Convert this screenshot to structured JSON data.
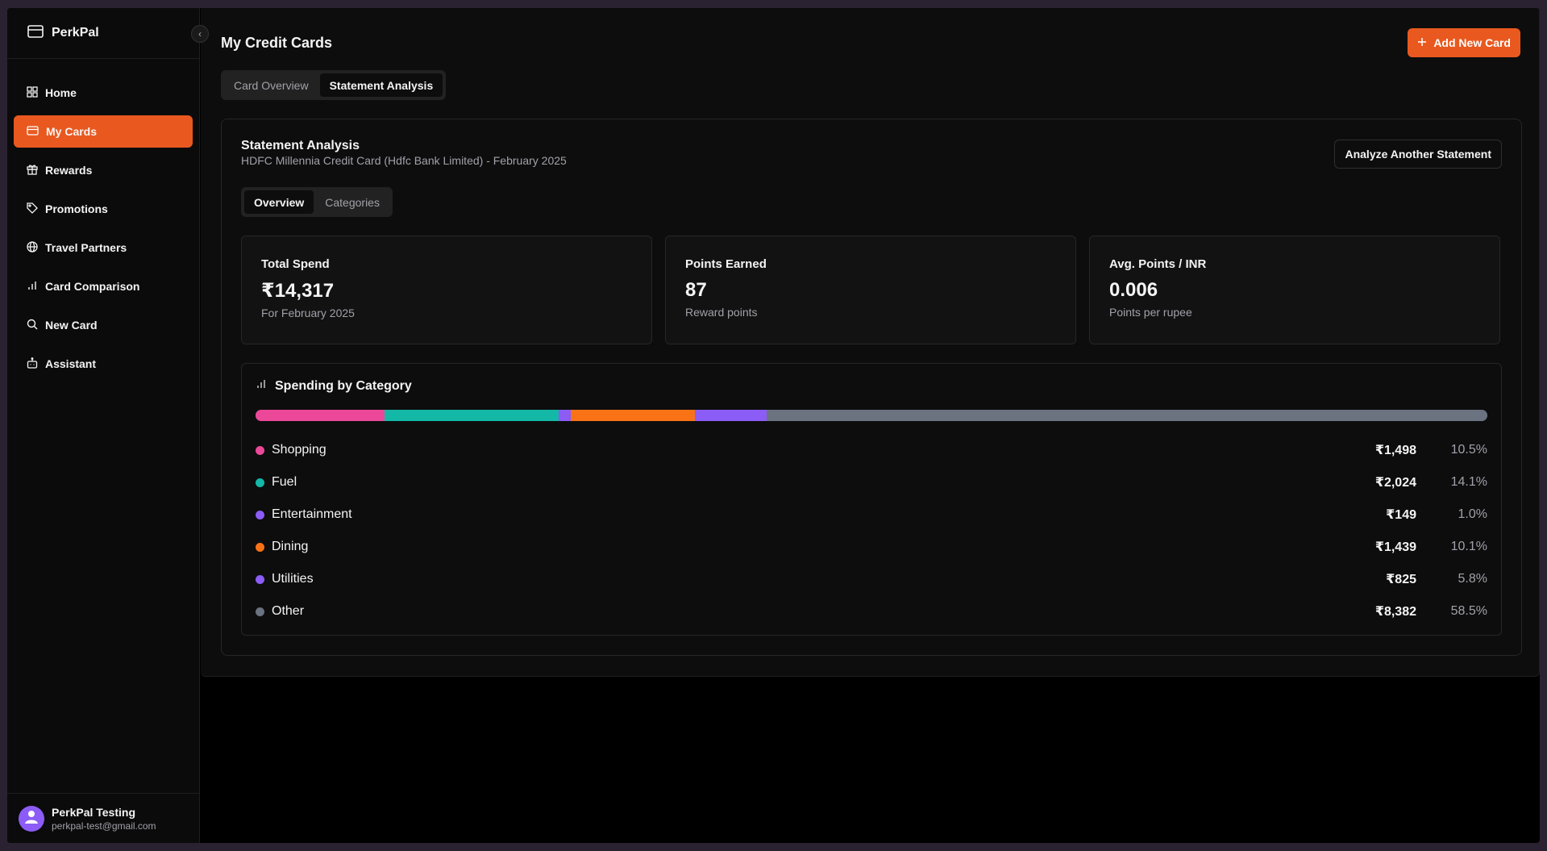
{
  "app": {
    "name": "PerkPal"
  },
  "sidebar": {
    "items": [
      {
        "label": "Home",
        "icon": "grid-icon",
        "active": false
      },
      {
        "label": "My Cards",
        "icon": "credit-card-icon",
        "active": true
      },
      {
        "label": "Rewards",
        "icon": "gift-icon",
        "active": false
      },
      {
        "label": "Promotions",
        "icon": "tag-icon",
        "active": false
      },
      {
        "label": "Travel Partners",
        "icon": "globe-icon",
        "active": false
      },
      {
        "label": "Card Comparison",
        "icon": "bar-chart-icon",
        "active": false
      },
      {
        "label": "New Card",
        "icon": "search-icon",
        "active": false
      },
      {
        "label": "Assistant",
        "icon": "bot-icon",
        "active": false
      }
    ],
    "user": {
      "name": "PerkPal Testing",
      "email": "perkpal-test@gmail.com"
    }
  },
  "header": {
    "title": "My Credit Cards",
    "add_button": "Add New Card",
    "tabs": [
      "Card Overview",
      "Statement Analysis"
    ],
    "active_tab": "Statement Analysis"
  },
  "analysis": {
    "title": "Statement Analysis",
    "subtitle": "HDFC Millennia Credit Card (Hdfc Bank Limited) - February 2025",
    "analyze_button": "Analyze Another Statement",
    "subtabs": [
      "Overview",
      "Categories"
    ],
    "active_subtab": "Overview",
    "stats": [
      {
        "label": "Total Spend",
        "value": "₹14,317",
        "note": "For February 2025"
      },
      {
        "label": "Points Earned",
        "value": "87",
        "note": "Reward points"
      },
      {
        "label": "Avg. Points / INR",
        "value": "0.006",
        "note": "Points per rupee"
      }
    ]
  },
  "spending": {
    "title": "Spending by Category",
    "categories": [
      {
        "name": "Shopping",
        "amount": "₹1,498",
        "percent": "10.5%",
        "share": 10.5,
        "color": "#ec4899"
      },
      {
        "name": "Fuel",
        "amount": "₹2,024",
        "percent": "14.1%",
        "share": 14.1,
        "color": "#14b8a6"
      },
      {
        "name": "Entertainment",
        "amount": "₹149",
        "percent": "1.0%",
        "share": 1.0,
        "color": "#8b5cf6"
      },
      {
        "name": "Dining",
        "amount": "₹1,439",
        "percent": "10.1%",
        "share": 10.1,
        "color": "#f97316"
      },
      {
        "name": "Utilities",
        "amount": "₹825",
        "percent": "5.8%",
        "share": 5.8,
        "color": "#8b5cf6"
      },
      {
        "name": "Other",
        "amount": "₹8,382",
        "percent": "58.5%",
        "share": 58.5,
        "color": "#6b7280"
      }
    ]
  },
  "colors": {
    "accent": "#e9591f",
    "background": "#0d0d0d"
  }
}
